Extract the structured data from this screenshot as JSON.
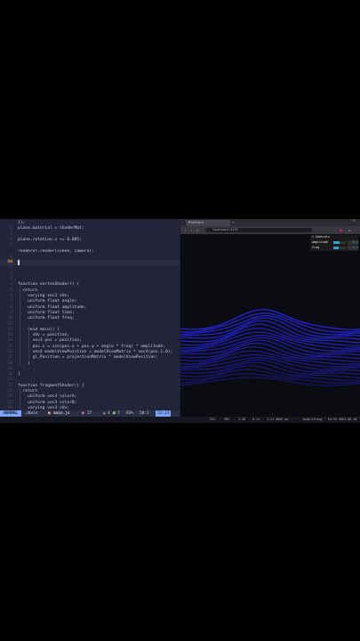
{
  "editor": {
    "lines": [
      {
        "num": "",
        "text": "});"
      },
      {
        "num": "4",
        "text": "plane.material = shaderMat;"
      },
      {
        "num": "3",
        "text": ""
      },
      {
        "num": "2",
        "text": "plane.rotation.x += 0.005;"
      },
      {
        "num": "1",
        "text": ""
      },
      {
        "num": "",
        "text": "renderer.render(scene, camera);"
      },
      {
        "num": "1",
        "text": ""
      },
      {
        "num": "50",
        "text": "}",
        "current": true
      },
      {
        "num": "1",
        "text": ""
      },
      {
        "num": "2",
        "text": ""
      },
      {
        "num": "3",
        "text": ""
      },
      {
        "num": "4",
        "text": "function vertexShader() {"
      },
      {
        "num": "5",
        "text": "  return `"
      },
      {
        "num": "6",
        "text": "    varying vec3 vUv;"
      },
      {
        "num": "7",
        "text": "    uniform float angle;"
      },
      {
        "num": "8",
        "text": "    uniform float amplitude;"
      },
      {
        "num": "9",
        "text": "    uniform float time;"
      },
      {
        "num": "10",
        "text": "    uniform float freq;"
      },
      {
        "num": "11",
        "text": ""
      },
      {
        "num": "12",
        "text": "    void main() {"
      },
      {
        "num": "13",
        "text": "      vUv = position;"
      },
      {
        "num": "14",
        "text": "      vec3 pos = position;"
      },
      {
        "num": "15",
        "text": "      pos.z = sin(pos.x + pos.y + angle * freq) * amplitude;"
      },
      {
        "num": "16",
        "text": "      vec4 modelViewPosition = modelViewMatrix * vec4(pos,1.0);"
      },
      {
        "num": "17",
        "text": "      gl_Position = projectionMatrix * modelViewPosition;"
      },
      {
        "num": "18",
        "text": "    }"
      },
      {
        "num": "19",
        "text": "  `"
      },
      {
        "num": "20",
        "text": "}"
      },
      {
        "num": "21",
        "text": ""
      },
      {
        "num": "22",
        "text": "function fragmentShader() {"
      },
      {
        "num": "23",
        "text": "  return `"
      },
      {
        "num": "24",
        "text": "    uniform vec3 colorA;"
      },
      {
        "num": "25",
        "text": "    uniform vec3 colorB;"
      },
      {
        "num": "26",
        "text": "    varying vec3 vUv;"
      }
    ]
  },
  "statusline": {
    "mode": "NORMAL",
    "branch": "main",
    "file": "main.js",
    "errors": "27",
    "warnings": "4",
    "hints": "7",
    "percent": "83%",
    "col": "50:1",
    "position": "21:24"
  },
  "browser": {
    "tab_title": "Plotters",
    "url": "localhost:5173",
    "gui": {
      "title": "Controls",
      "rows": [
        {
          "label": "amplitude",
          "value": "0.5",
          "fill": 0.5
        },
        {
          "label": "freq",
          "value": "0.4",
          "fill": 0.4
        }
      ]
    }
  },
  "taskbar": {
    "items": [
      "22%",
      "19%",
      "1.3G",
      "0.1%",
      "1.21 GHz",
      "2 up"
    ],
    "right": "fpsblitting · 14:53 2023-06-16"
  },
  "colors": {
    "editor_bg": "#222539",
    "accent": "#7aa2f7",
    "wave": "#2a2bff"
  }
}
